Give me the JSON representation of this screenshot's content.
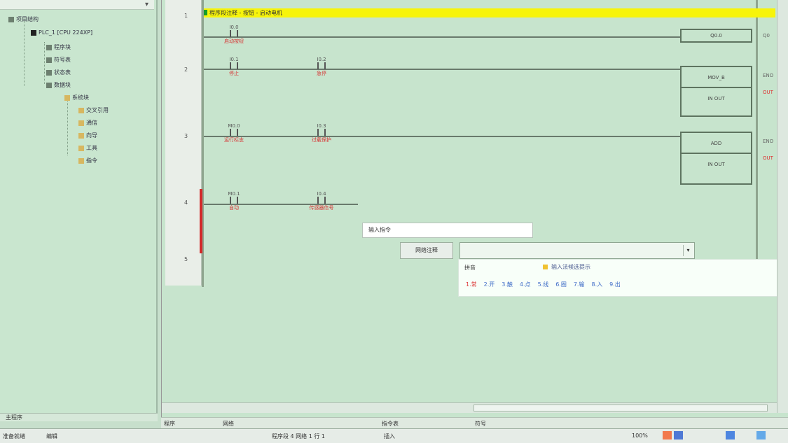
{
  "tree": {
    "items": [
      {
        "label": "项目结构"
      },
      {
        "label": "PLC_1 [CPU 224XP]"
      },
      {
        "label": "程序块"
      },
      {
        "label": "符号表"
      },
      {
        "label": "状态表"
      },
      {
        "label": "数据块"
      },
      {
        "label": "系统块"
      },
      {
        "label": "交叉引用"
      },
      {
        "label": "通信"
      },
      {
        "label": "向导"
      },
      {
        "label": "工具"
      },
      {
        "label": "指令"
      }
    ],
    "bottom_tab": "主程序"
  },
  "editor": {
    "title": "程序段注释 - 按钮 - 启动电机",
    "rungs": [
      "1",
      "2",
      "3",
      "4",
      "5"
    ],
    "contacts": [
      {
        "addr": "I0.0",
        "label": "启动按钮"
      },
      {
        "addr": "I0.1",
        "label": "停止"
      },
      {
        "addr": "I0.2",
        "label": "急停"
      },
      {
        "addr": "M0.0",
        "label": "运行标志"
      },
      {
        "addr": "I0.3",
        "label": "过载保护"
      },
      {
        "addr": "M0.1",
        "label": "自动"
      },
      {
        "addr": "I0.4",
        "label": "传感器信号"
      }
    ],
    "coils": [
      {
        "label": "Q0.0"
      },
      {
        "label": "MOV_B"
      },
      {
        "label": "IN OUT"
      },
      {
        "label": "ADD"
      },
      {
        "label": "IN OUT"
      }
    ],
    "side_marks": [
      "Q0",
      "ENO",
      "OUT",
      "ENO",
      "OUT"
    ],
    "edit_value": "输入指令",
    "button": "网络注释",
    "ime": {
      "label": "拼音",
      "hint": "输入法候选提示",
      "candidates": [
        "1.常",
        "2.开",
        "3.触",
        "4.点",
        "5.线",
        "6.圈",
        "7.输",
        "8.入",
        "9.出"
      ]
    }
  },
  "status": {
    "line1": [
      "程序",
      "网络",
      "指令表",
      "符号"
    ],
    "line2_left": [
      "准备就绪",
      "编辑"
    ],
    "line2_mid": [
      "程序段 4  网络 1  行 1",
      "插入"
    ],
    "line2_right": "100%"
  },
  "colors": {
    "title_bar": "#f7f40a",
    "red_labels": "#d73232",
    "accent": "#3d6bc7"
  }
}
